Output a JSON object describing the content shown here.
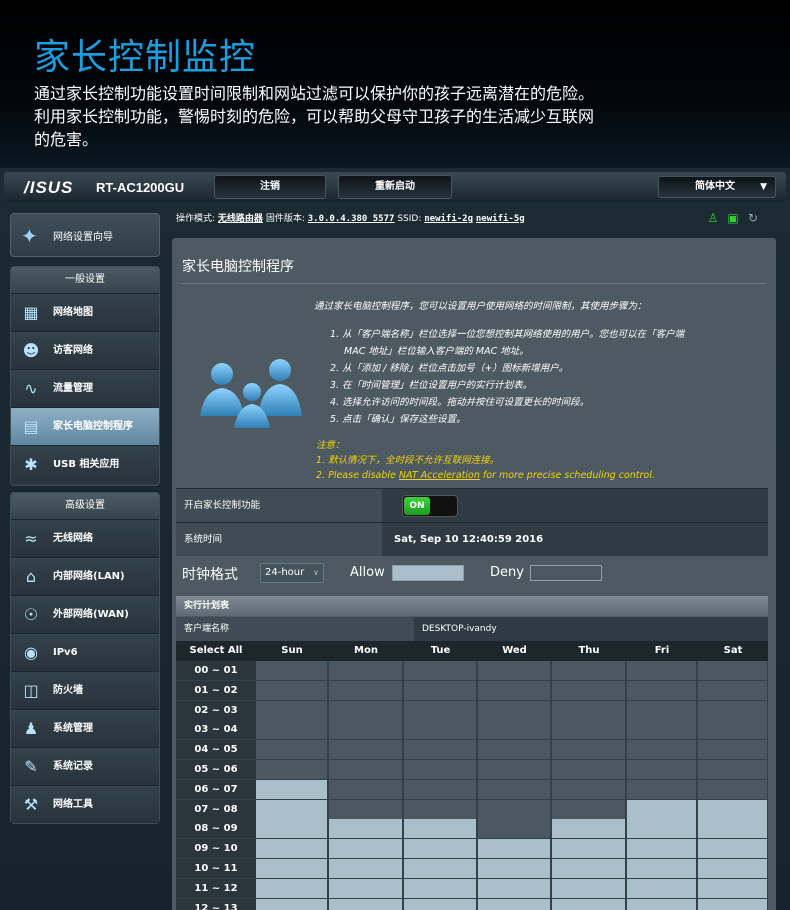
{
  "banner": {
    "title": "家长控制监控",
    "line1": "通过家长控制功能设置时间限制和网站过滤可以保护你的孩子远离潜在的危险。",
    "line2": "利用家长控制功能，警惕时刻的危险，可以帮助父母守卫孩子的生活减少互联网",
    "line3": "的危害。"
  },
  "topbar": {
    "logo": "/ISUS",
    "model": "RT-AC1200GU",
    "logout_label": "注销",
    "reboot_label": "重新启动",
    "language": "简体中文"
  },
  "infobar": {
    "mode_label": "操作模式:",
    "mode_value": "无线路由器",
    "fw_label": "固件版本:",
    "fw_value": "3.0.0.4.380_5577",
    "ssid_label": "SSID:",
    "ssid1": "newifi-2g",
    "ssid2": "newifi-5g"
  },
  "sidebar": {
    "wizard": "网络设置向导",
    "general_head": "一般设置",
    "general": [
      {
        "label": "网络地图",
        "icon": "network-map-icon"
      },
      {
        "label": "访客网络",
        "icon": "guest-network-icon"
      },
      {
        "label": "流量管理",
        "icon": "traffic-manager-icon"
      },
      {
        "label": "家长电脑控制程序",
        "icon": "parental-control-icon"
      },
      {
        "label": "USB 相关应用",
        "icon": "usb-app-icon"
      }
    ],
    "advanced_head": "高级设置",
    "advanced": [
      {
        "label": "无线网络",
        "icon": "wireless-icon"
      },
      {
        "label": "内部网络(LAN)",
        "icon": "lan-icon"
      },
      {
        "label": "外部网络(WAN)",
        "icon": "wan-icon"
      },
      {
        "label": "IPv6",
        "icon": "ipv6-icon"
      },
      {
        "label": "防火墙",
        "icon": "firewall-icon"
      },
      {
        "label": "系统管理",
        "icon": "administration-icon"
      },
      {
        "label": "系统记录",
        "icon": "system-log-icon"
      },
      {
        "label": "网络工具",
        "icon": "network-tools-icon"
      }
    ]
  },
  "panel": {
    "title": "家长电脑控制程序",
    "intro": "通过家长电脑控制程序，您可以设置用户使用网络的时间限制，其使用步骤为：",
    "steps": [
      "1. 从「客户端名称」栏位选择一位您想控制其网络使用的用户。您也可以在「客户端",
      "MAC 地址」栏位输入客户端的 MAC 地址。",
      "2. 从「添加 / 移除」栏位点击加号（+）图标新增用户。",
      "3. 在「时间管理」栏位设置用户的实行计划表。",
      "4. 选择允许访问的时间段。拖动并按住可设置更长的时间段。",
      "5. 点击「确认」保存这些设置。"
    ],
    "note_head": "注意：",
    "note1": "1. 默认情况下，全时段不允许互联网连接。",
    "note2_pre": "2. Please disable ",
    "note2_link": "NAT Acceleration",
    "note2_post": " for more precise scheduling control.",
    "enable_label": "开启家长控制功能",
    "toggle_state": "ON",
    "time_label": "系统时间",
    "time_value": "Sat, Sep 10 12:40:59 2016",
    "clock_label": "时钟格式",
    "clock_value": "24-hour",
    "allow_label": "Allow",
    "deny_label": "Deny",
    "schedule_head": "实行计划表",
    "client_label": "客户端名称",
    "client_value": "DESKTOP-ivandy"
  },
  "schedule": {
    "select_all": "Select All",
    "days": [
      "Sun",
      "Mon",
      "Tue",
      "Wed",
      "Thu",
      "Fri",
      "Sat"
    ],
    "rows": [
      {
        "label": "00 ~ 01",
        "allow": [
          0,
          0,
          0,
          0,
          0,
          0,
          0
        ]
      },
      {
        "label": "01 ~ 02",
        "allow": [
          0,
          0,
          0,
          0,
          0,
          0,
          0
        ]
      },
      {
        "label": "02 ~ 03",
        "allow": [
          0,
          0,
          0,
          0,
          0,
          0,
          0
        ]
      },
      {
        "label": "03 ~ 04",
        "allow": [
          0,
          0,
          0,
          0,
          0,
          0,
          0
        ]
      },
      {
        "label": "04 ~ 05",
        "allow": [
          0,
          0,
          0,
          0,
          0,
          0,
          0
        ]
      },
      {
        "label": "05 ~ 06",
        "allow": [
          0,
          0,
          0,
          0,
          0,
          0,
          0
        ]
      },
      {
        "label": "06 ~ 07",
        "allow": [
          1,
          0,
          0,
          0,
          0,
          0,
          0
        ]
      },
      {
        "label": "07 ~ 08",
        "allow": [
          1,
          0,
          0,
          0,
          0,
          1,
          1
        ]
      },
      {
        "label": "08 ~ 09",
        "allow": [
          1,
          1,
          1,
          0,
          1,
          1,
          1
        ]
      },
      {
        "label": "09 ~ 10",
        "allow": [
          1,
          1,
          1,
          1,
          1,
          1,
          1
        ]
      },
      {
        "label": "10 ~ 11",
        "allow": [
          1,
          1,
          1,
          1,
          1,
          1,
          1
        ]
      },
      {
        "label": "11 ~ 12",
        "allow": [
          1,
          1,
          1,
          1,
          1,
          1,
          1
        ]
      },
      {
        "label": "12 ~ 13",
        "allow": [
          1,
          1,
          1,
          1,
          1,
          1,
          1
        ]
      }
    ]
  }
}
